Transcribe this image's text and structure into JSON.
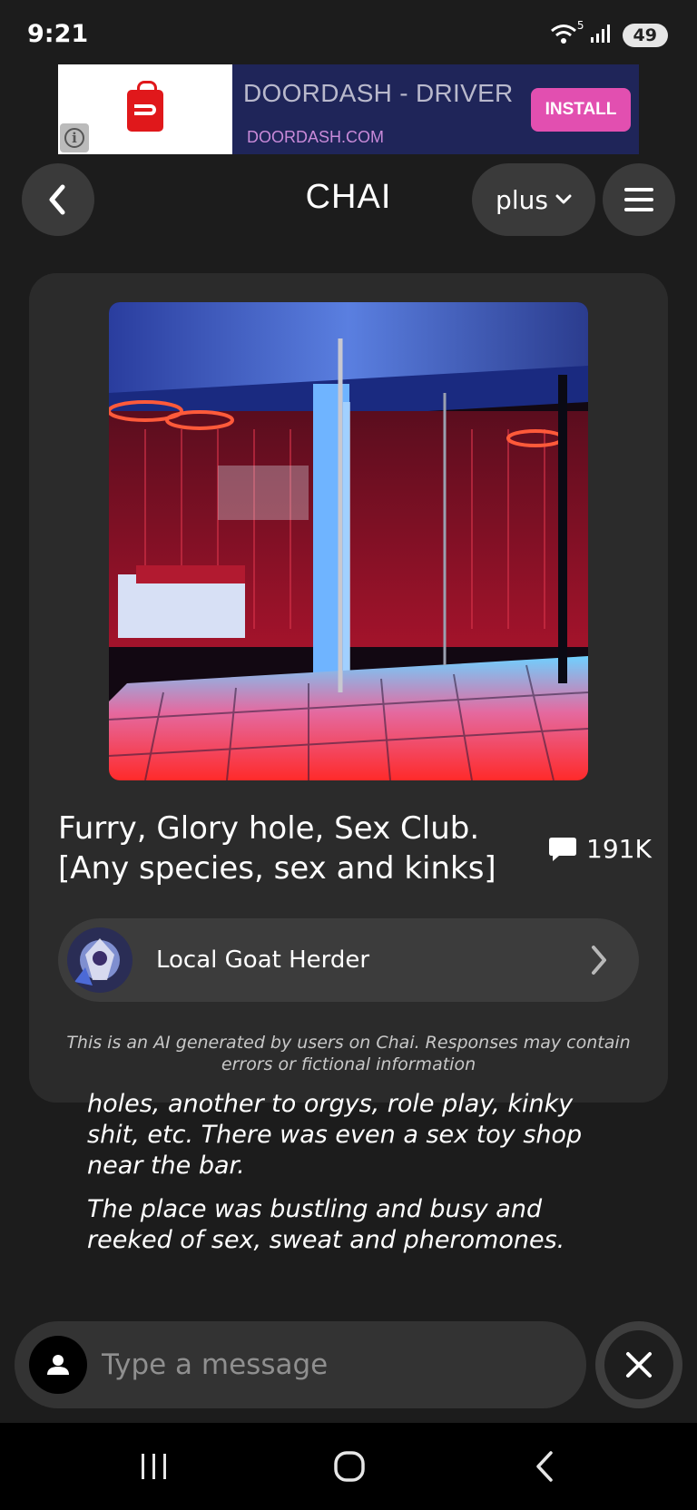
{
  "status_bar": {
    "time": "9:21",
    "wifi_label": "5",
    "battery": "49"
  },
  "ad": {
    "title": "DOORDASH - DRIVER",
    "url": "DOORDASH.COM",
    "install_label": "INSTALL",
    "colors": {
      "background": "#1f2559",
      "install": "#e24fb0",
      "brand": "#e0181b"
    }
  },
  "header": {
    "title": "CHAI",
    "plan_label": "plus"
  },
  "bot_card": {
    "name": "Furry, Glory hole, Sex Club. [Any species, sex and kinks]",
    "message_count": "191K",
    "creator": "Local Goat Herder",
    "disclaimer": "This is an AI generated by users on Chai. Responses may contain errors or fictional information"
  },
  "chat": {
    "paragraphs": [
      "holes, another to orgys, role play, kinky shit, etc. There was even a sex toy shop near the bar.",
      "The place was bustling and busy and reeked of sex, sweat and pheromones."
    ]
  },
  "composer": {
    "placeholder": "Type a message"
  },
  "icons": {
    "back": "chevron-left-icon",
    "plan_dropdown": "chevron-down-icon",
    "menu": "hamburger-menu-icon",
    "messages": "chat-bubble-icon",
    "creator_link": "chevron-right-icon",
    "user": "user-icon",
    "close": "close-icon",
    "nav_recents": "recents-icon",
    "nav_home": "home-icon",
    "nav_back": "nav-back-icon"
  }
}
